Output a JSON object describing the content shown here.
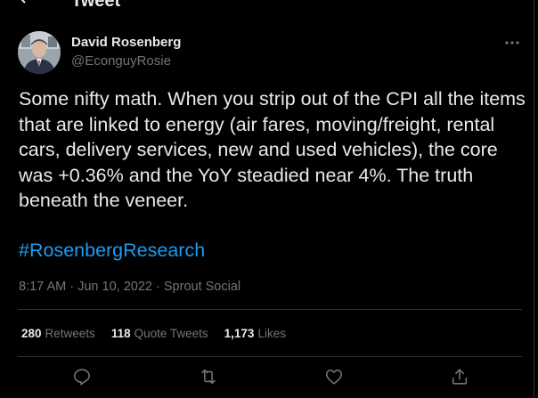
{
  "header": {
    "title": "Tweet"
  },
  "tweet": {
    "author": {
      "name": "David Rosenberg",
      "handle": "@EconguyRosie"
    },
    "text": "Some nifty math. When you strip out of the CPI all the items that are linked to energy (air fares, moving/freight, rental cars, delivery services, new and used vehicles), the core was +0.36% and the YoY steadied near 4%. The truth beneath the veneer.",
    "hashtag": "#RosenbergResearch",
    "time": "8:17 AM",
    "separator": "·",
    "date": "Jun 10, 2022",
    "source": "Sprout Social"
  },
  "stats": {
    "retweets_count": "280",
    "retweets_label": "Retweets",
    "quotes_count": "118",
    "quotes_label": "Quote Tweets",
    "likes_count": "1,173",
    "likes_label": "Likes"
  },
  "icons": {
    "back": "back-arrow-icon",
    "more": "more-icon",
    "reply": "reply-icon",
    "retweet": "retweet-icon",
    "like": "like-icon",
    "share": "share-icon"
  },
  "colors": {
    "background": "#000000",
    "text": "#e7e9ea",
    "secondary_text": "#71767b",
    "link": "#1d9bf0",
    "divider": "#2f3336"
  }
}
